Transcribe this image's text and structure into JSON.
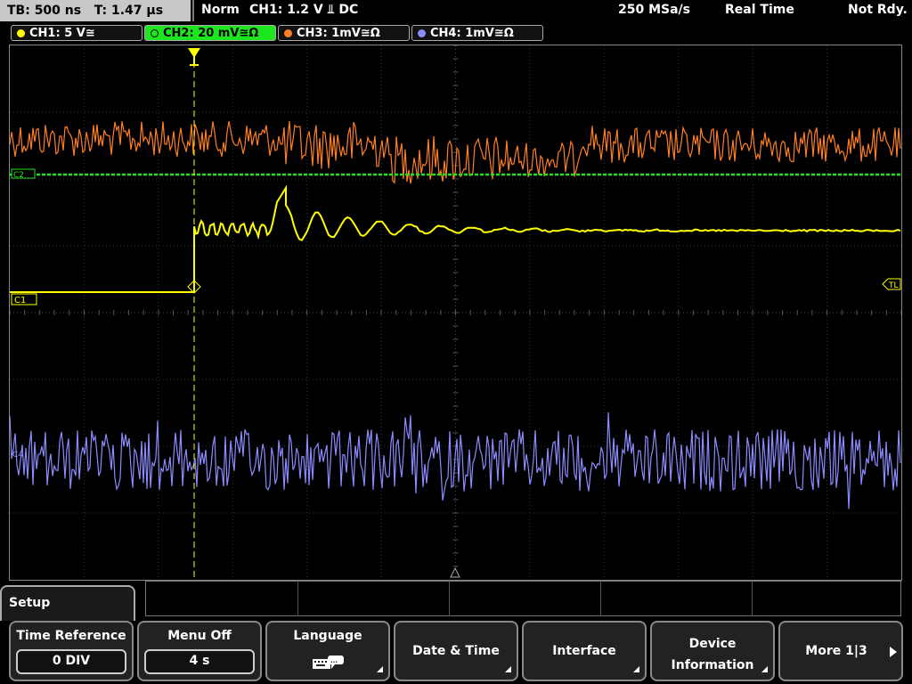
{
  "status_bar": {
    "timebase": "TB: 500 ns",
    "trigger_time": "T: 1.47 µs",
    "acq_mode": "Norm",
    "trigger_info": "CH1: 1.2 V ⫫ DC",
    "sample_rate": "250 MSa/s",
    "acq_type": "Real Time",
    "trigger_status": "Not Rdy."
  },
  "channels": [
    {
      "label": "CH1: 5 V≅",
      "color": "#ffff00"
    },
    {
      "label": "CH2: 20 mV≅Ω",
      "color": "#1ee61e"
    },
    {
      "label": "CH3: 1mV≅Ω",
      "color": "#ff7f27"
    },
    {
      "label": "CH4: 1mV≅Ω",
      "color": "#8c8cff"
    }
  ],
  "markers": {
    "ch1": "C1",
    "ch2": "C2",
    "ch4": "C4",
    "trigger_level": "TL"
  },
  "menu": {
    "title": "Setup",
    "softkeys": [
      {
        "label": "Time Reference",
        "value": "0 DIV"
      },
      {
        "label": "Menu Off",
        "value": "4 s"
      },
      {
        "label": "Language",
        "icon": "keyboard-icon"
      },
      {
        "label": "Date & Time"
      },
      {
        "label": "Interface"
      },
      {
        "label": "Device",
        "label2": "Information"
      },
      {
        "label": "More 1|3"
      }
    ]
  }
}
